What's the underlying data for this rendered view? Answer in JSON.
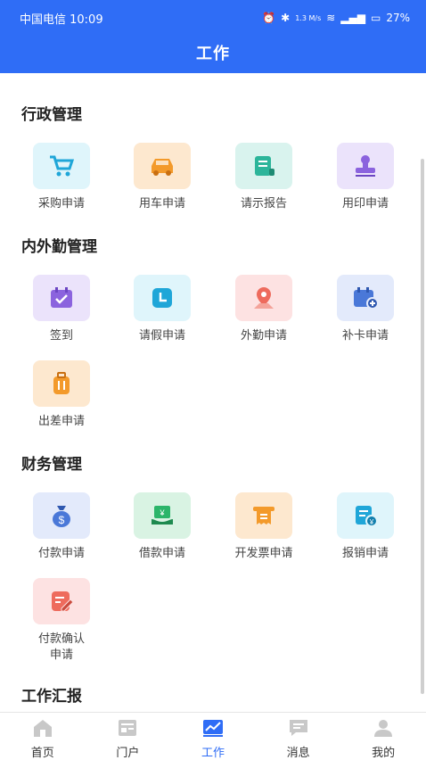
{
  "status_bar": {
    "carrier_time": "中国电信 10:09",
    "speed": "1.3 M/s",
    "battery": "27%"
  },
  "header": {
    "title": "工作"
  },
  "sections": [
    {
      "title": "行政管理",
      "items": [
        {
          "label": "采购申请",
          "icon": "cart-icon",
          "bg": "#dff5fb",
          "fg": "#1fa6d8"
        },
        {
          "label": "用车申请",
          "icon": "car-icon",
          "bg": "#fde8cf",
          "fg": "#f39a2b"
        },
        {
          "label": "请示报告",
          "icon": "scroll-icon",
          "bg": "#d9f3ee",
          "fg": "#2cb59a"
        },
        {
          "label": "用印申请",
          "icon": "stamp-icon",
          "bg": "#ebe3fb",
          "fg": "#8b63de"
        }
      ]
    },
    {
      "title": "内外勤管理",
      "items": [
        {
          "label": "签到",
          "icon": "calendar-check-icon",
          "bg": "#ebe3fb",
          "fg": "#8b63de"
        },
        {
          "label": "请假申请",
          "icon": "clock-icon",
          "bg": "#dff5fb",
          "fg": "#1fa6d8"
        },
        {
          "label": "外勤申请",
          "icon": "location-icon",
          "bg": "#fde2e2",
          "fg": "#ee6b5d"
        },
        {
          "label": "补卡申请",
          "icon": "calendar-add-icon",
          "bg": "#e3eafb",
          "fg": "#4a78d8"
        },
        {
          "label": "出差申请",
          "icon": "luggage-icon",
          "bg": "#fde8cf",
          "fg": "#f39a2b"
        }
      ]
    },
    {
      "title": "财务管理",
      "items": [
        {
          "label": "付款申请",
          "icon": "money-bag-icon",
          "bg": "#e3eafb",
          "fg": "#4a78d8"
        },
        {
          "label": "借款申请",
          "icon": "cash-icon",
          "bg": "#d9f3e3",
          "fg": "#2cb56a"
        },
        {
          "label": "开发票申请",
          "icon": "invoice-icon",
          "bg": "#fde8cf",
          "fg": "#f39a2b"
        },
        {
          "label": "报销申请",
          "icon": "receipt-icon",
          "bg": "#dff5fb",
          "fg": "#1fa6d8"
        },
        {
          "label": "付款确认申请",
          "icon": "edit-doc-icon",
          "bg": "#fde2e2",
          "fg": "#ee6b5d"
        }
      ]
    },
    {
      "title": "工作汇报",
      "items": []
    }
  ],
  "tabs": [
    {
      "label": "首页",
      "icon": "home-icon",
      "active": false
    },
    {
      "label": "门户",
      "icon": "portal-icon",
      "active": false
    },
    {
      "label": "工作",
      "icon": "chart-icon",
      "active": true
    },
    {
      "label": "消息",
      "icon": "message-icon",
      "active": false
    },
    {
      "label": "我的",
      "icon": "user-icon",
      "active": false
    }
  ],
  "colors": {
    "primary": "#2f6df6",
    "inactive_tab": "#c8c8c8"
  }
}
